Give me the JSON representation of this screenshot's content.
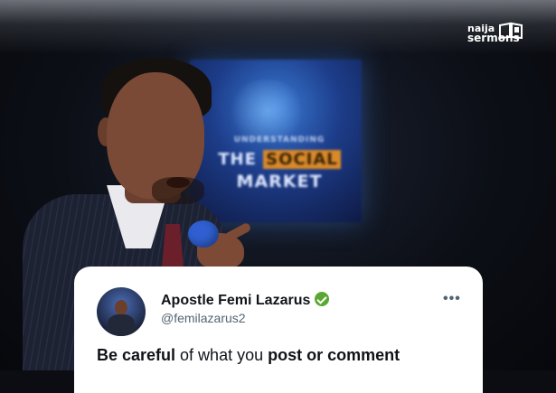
{
  "background": {
    "screen_text": [
      "UNDERSTANDING",
      "THE",
      "SOCIAL",
      "MARKET"
    ]
  },
  "brand": {
    "logo_line1": "naija",
    "logo_line2": "sermons"
  },
  "post": {
    "author_name": "Apostle Femi Lazarus",
    "verified": true,
    "handle": "@femilazarus2",
    "more_icon": "more-options-icon",
    "text_part1": "Be careful",
    "text_part2": " of what you ",
    "text_part3": "post or comment"
  },
  "colors": {
    "verified_badge": "#5aa832",
    "card_bg": "#ffffff",
    "handle_gray": "#536471",
    "mic_blue": "#2f5fd0"
  }
}
